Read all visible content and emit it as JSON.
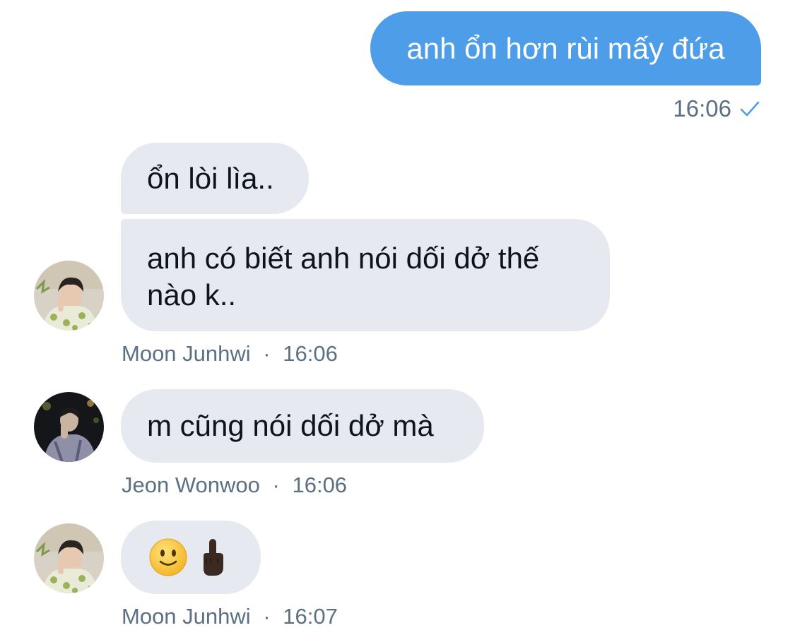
{
  "messages": {
    "sent": {
      "text": "anh ổn hơn rùi mấy đứa",
      "time": "16:06",
      "status_icon": "check-icon"
    },
    "group1": {
      "bubble1": "ổn lòi lìa..",
      "bubble2": "anh có biết anh nói dối dở thế nào k..",
      "author": "Moon Junhwi",
      "separator": "·",
      "time": "16:06"
    },
    "group2": {
      "bubble": "m cũng nói dối dở mà",
      "author": "Jeon Wonwoo",
      "separator": "·",
      "time": "16:06"
    },
    "group3": {
      "emojis": [
        "slightly-smiling-face-emoji",
        "middle-finger-dark-skin-emoji"
      ],
      "author": "Moon Junhwi",
      "separator": "·",
      "time": "16:07"
    }
  },
  "colors": {
    "sent_bubble": "#4e9de8",
    "received_bubble": "#e7e9f1",
    "meta_text": "#5b7083",
    "check": "#4e9de8"
  }
}
